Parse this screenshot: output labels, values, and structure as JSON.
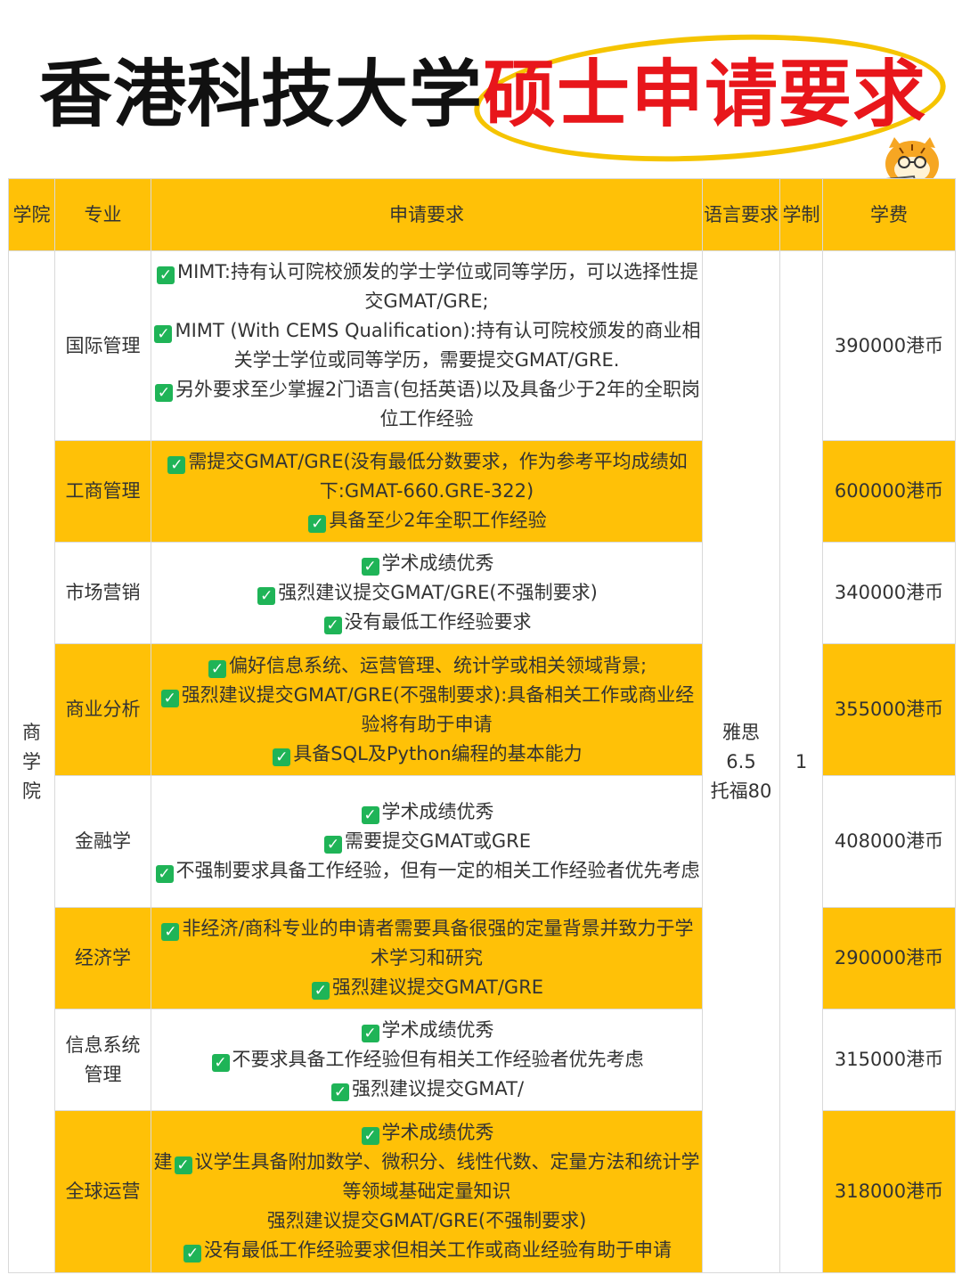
{
  "title": {
    "part1": "香港科技大学",
    "part2": "硕士申请要求"
  },
  "headers": {
    "school": [
      "学",
      "院"
    ],
    "major": "专业",
    "requirements": "申请要求",
    "language": [
      "语言",
      "要求"
    ],
    "duration": [
      "学",
      "制"
    ],
    "fee": "学费"
  },
  "school": [
    "商",
    "学",
    "院"
  ],
  "language_req": [
    "雅思",
    "6.5",
    "托福80"
  ],
  "duration": "1",
  "programs": [
    {
      "major": [
        "国际管理"
      ],
      "fee": "390000港币",
      "lines": [
        {
          "check": true,
          "text": "MIMT:持有认可院校颁发的学士学位或同等学历，可以选择性提交GMAT/GRE;"
        },
        {
          "check": true,
          "text": "MIMT (With CEMS Qualification):持有认可院校颁发的商业相关学士学位或同等学历，需要提交GMAT/GRE."
        },
        {
          "check": true,
          "text": "另外要求至少掌握2门语言(包括英语)以及具备少于2年的全职岗位工作经验"
        }
      ]
    },
    {
      "major": [
        "工商管理"
      ],
      "fee": "600000港币",
      "lines": [
        {
          "check": true,
          "text": "需提交GMAT/GRE(没有最低分数要求，作为参考平均成绩如下:GMAT-660.GRE-322)"
        },
        {
          "check": true,
          "text": "具备至少2年全职工作经验"
        }
      ]
    },
    {
      "major": [
        "市场营销"
      ],
      "fee": "340000港币",
      "lines": [
        {
          "check": true,
          "text": "学术成绩优秀"
        },
        {
          "check": true,
          "text": "强烈建议提交GMAT/GRE(不强制要求)"
        },
        {
          "check": true,
          "text": "没有最低工作经验要求"
        }
      ]
    },
    {
      "major": [
        "商业分析"
      ],
      "fee": "355000港币",
      "lines": [
        {
          "check": true,
          "text": "偏好信息系统、运营管理、统计学或相关领域背景;"
        },
        {
          "check": true,
          "text": "强烈建议提交GMAT/GRE(不强制要求):具备相关工作或商业经验将有助于申请"
        },
        {
          "check": true,
          "text": "具备SQL及Python编程的基本能力"
        }
      ]
    },
    {
      "major": [
        "金融学"
      ],
      "fee": "408000港币",
      "lines": [
        {
          "check": true,
          "text": "学术成绩优秀"
        },
        {
          "check": true,
          "text": "需要提交GMAT或GRE"
        },
        {
          "check": true,
          "text": "不强制要求具备工作经验，但有一定的相关工作经验者优先考虑"
        }
      ]
    },
    {
      "major": [
        "经济学"
      ],
      "fee": "290000港币",
      "lines": [
        {
          "check": true,
          "text": "非经济/商科专业的申请者需要具备很强的定量背景并致力于学术学习和研究"
        },
        {
          "check": true,
          "text": "强烈建议提交GMAT/GRE"
        }
      ]
    },
    {
      "major": [
        "信息系统",
        "管理"
      ],
      "fee": "315000港币",
      "lines": [
        {
          "check": true,
          "text": "学术成绩优秀"
        },
        {
          "check": true,
          "text": "不要求具备工作经验但有相关工作经验者优先考虑"
        },
        {
          "check": true,
          "text": "强烈建议提交GMAT/"
        }
      ]
    },
    {
      "major": [
        "全球运营"
      ],
      "fee": "318000港币",
      "lines": [
        {
          "check": true,
          "text": "学术成绩优秀"
        },
        {
          "check": false,
          "prefix": "建",
          "mid_check": true,
          "text": "议学生具备附加数学、微积分、线性代数、定量方法和统计学等领域基础定量知识"
        },
        {
          "check": false,
          "text": "强烈建议提交GMAT/GRE(不强制要求)"
        },
        {
          "check": true,
          "text": "没有最低工作经验要求但相关工作或商业经验有助于申请"
        }
      ]
    }
  ],
  "colors": {
    "accent": "#ffc107",
    "title_red": "#e8161b",
    "check_green": "#1fb457"
  }
}
